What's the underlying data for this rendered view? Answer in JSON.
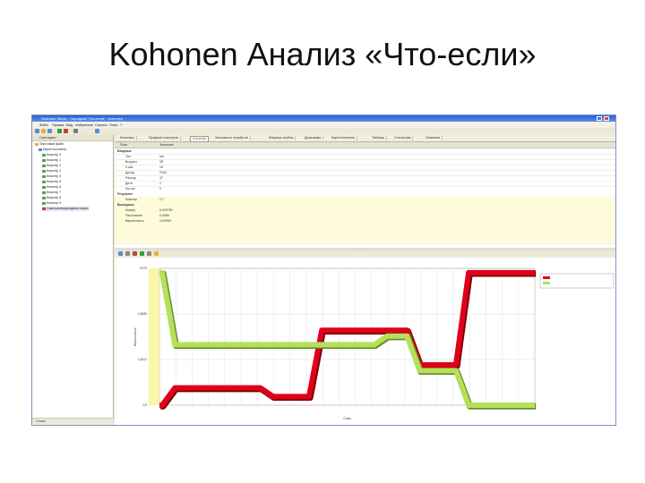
{
  "slide": {
    "title": "Kohonen Анализ «Что-если»"
  },
  "app": {
    "window_title": "Deductor Studio - Сценарий \"Что-если\" - Kohonen",
    "menu": [
      "Файл",
      "Правка",
      "Вид",
      "Избранное",
      "Сервис",
      "Окна",
      "?"
    ],
    "tabs": [
      "Кластеры",
      "Профили кластеров",
      "Что-если",
      "Значимость атрибутов",
      "Матрица ошибок",
      "Диаграмма",
      "Карта Кохонена",
      "Таблица",
      "Статистика",
      "Описание"
    ],
    "active_tab": 2,
    "tree": {
      "header": "Сценарии",
      "items": [
        "Текстовый файл",
        "Карта Кохонена",
        "Кластер 0",
        "Кластер 1",
        "Кластер 2",
        "Кластер 3",
        "Кластер 4",
        "Кластер 5",
        "Кластер 6",
        "Кластер 7",
        "Кластер 8",
        "Кластер 9",
        "Самоорганизующиеся карты"
      ]
    },
    "table": {
      "col_field": "Поле",
      "col_value": "Значение",
      "inputs_label": "Входные",
      "outputs_label": "Выходные",
      "rows": [
        {
          "field": "Тип",
          "value": "нет"
        },
        {
          "field": "Возраст",
          "value": "38"
        },
        {
          "field": "Стаж",
          "value": "16"
        },
        {
          "field": "Доход",
          "value": "2154"
        },
        {
          "field": "Расход",
          "value": "47"
        },
        {
          "field": "Дети",
          "value": "2"
        },
        {
          "field": "Кол-во",
          "value": "0"
        }
      ],
      "section_row": {
        "field": "Результат",
        "value": ""
      },
      "highlighted_rows": [
        {
          "field": "Кластер",
          "value": "2,7"
        },
        {
          "field": "Номер",
          "value": "0,003750"
        },
        {
          "field": "Расстояние",
          "value": "0,0056"
        },
        {
          "field": "Вероятность",
          "value": "0,99999"
        }
      ],
      "splitter_label": "- - - - -"
    },
    "status": "Готово"
  },
  "chart_data": {
    "type": "line",
    "x_label_count": 24,
    "ylim": [
      0.5,
      0.975
    ],
    "yticks": [
      "0,975",
      "0,8083",
      "0,6417",
      "0,5"
    ],
    "ylabel": "Вероятность",
    "xlabel": "Стаж",
    "series": [
      {
        "name": "",
        "color": "#e0001a",
        "values": [
          0.5,
          0.56,
          0.56,
          0.56,
          0.56,
          0.56,
          0.56,
          0.53,
          0.53,
          0.53,
          0.76,
          0.76,
          0.76,
          0.76,
          0.76,
          0.76,
          0.64,
          0.64,
          0.64,
          0.96,
          0.96,
          0.96,
          0.96,
          0.96
        ]
      },
      {
        "name": "",
        "color": "#b5e05a",
        "values": [
          0.96,
          0.71,
          0.71,
          0.71,
          0.71,
          0.71,
          0.71,
          0.71,
          0.71,
          0.71,
          0.71,
          0.71,
          0.71,
          0.71,
          0.74,
          0.74,
          0.62,
          0.62,
          0.62,
          0.5,
          0.5,
          0.5,
          0.5,
          0.5
        ]
      }
    ],
    "legend": "top-right"
  },
  "colors": {
    "accent": "#2c5fc8",
    "highlight_row": "#fdfbd9"
  }
}
